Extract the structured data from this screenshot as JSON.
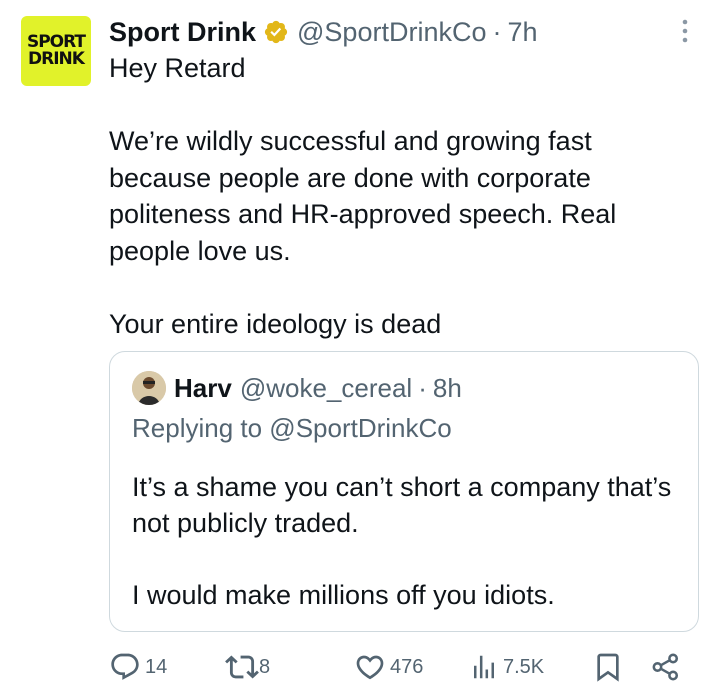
{
  "tweet": {
    "author_name": "Sport Drink",
    "handle": "@SportDrinkCo",
    "separator": "·",
    "time": "7h",
    "avatar_text_line1": "SPORT",
    "avatar_text_line2": "DRINK",
    "body_line1": "Hey Retard",
    "body_para2": "We’re wildly successful and growing fast because people are done with corporate politeness and HR-approved speech. Real people love us.",
    "body_para3": "Your entire ideology is dead"
  },
  "quoted_tweet": {
    "author_name": "Harv",
    "handle": "@woke_cereal",
    "separator": "·",
    "time": "8h",
    "replying_to": "Replying to @SportDrinkCo",
    "body_para1": "It’s a shame you can’t short a company that’s not publicly traded.",
    "body_para2": "I would make millions off you idiots."
  },
  "actions": {
    "replies": "14",
    "retweets": "8",
    "likes": "476",
    "views": "7.5K"
  },
  "colors": {
    "brand_yellow": "#e1f22a",
    "muted_text": "#536471",
    "verified_gold": "#e2b719"
  }
}
